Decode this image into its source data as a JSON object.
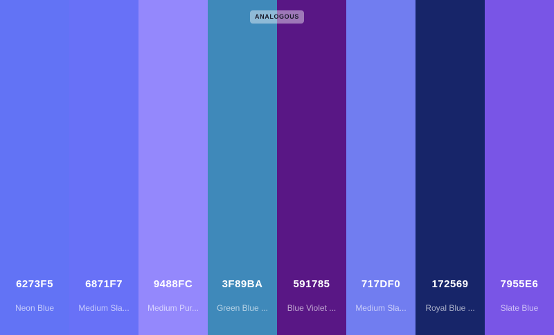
{
  "badge": "ANALOGOUS",
  "swatches": [
    {
      "hex": "6273F5",
      "name": "Neon Blue",
      "color": "#6273F5"
    },
    {
      "hex": "6871F7",
      "name": "Medium Sla...",
      "color": "#6871F7"
    },
    {
      "hex": "9488FC",
      "name": "Medium Pur...",
      "color": "#9488FC"
    },
    {
      "hex": "3F89BA",
      "name": "Green Blue ...",
      "color": "#3F89BA"
    },
    {
      "hex": "591785",
      "name": "Blue Violet ...",
      "color": "#591785"
    },
    {
      "hex": "717DF0",
      "name": "Medium Sla...",
      "color": "#717DF0"
    },
    {
      "hex": "172569",
      "name": "Royal Blue ...",
      "color": "#172569"
    },
    {
      "hex": "7955E6",
      "name": "Slate Blue",
      "color": "#7955E6"
    }
  ]
}
